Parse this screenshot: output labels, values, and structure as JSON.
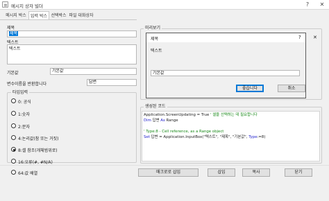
{
  "window": {
    "title": "메시지 상자 빌더",
    "help_glyph": "?",
    "close_glyph": "✕"
  },
  "tabs": [
    {
      "label": "메시지 박스",
      "active": false
    },
    {
      "label": "입력 박스",
      "active": true
    },
    {
      "label": "선택박스",
      "active": false
    },
    {
      "label": "파일 대화상자",
      "active": false
    }
  ],
  "form": {
    "title_label": "제목",
    "title_value": "제목",
    "message_label": "텍스트",
    "message_value": "텍스트",
    "default_label": "기본값",
    "default_value": "기본값",
    "return_var_label": "변수이름을 반환합니다",
    "return_var_value": "답변"
  },
  "input_type": {
    "legend": "타입입력",
    "options": [
      {
        "label": "0: 공식",
        "selected": false
      },
      {
        "label": "1:숫자",
        "selected": false
      },
      {
        "label": "2:문자",
        "selected": false
      },
      {
        "label": "4:논리값(참 또는 거짓)",
        "selected": false
      },
      {
        "label": "8:셀 참조(개체범위로)",
        "selected": true
      },
      {
        "label": "16:오류(#, #N/A)",
        "selected": false
      },
      {
        "label": "64:값 배열",
        "selected": false
      }
    ]
  },
  "preview": {
    "legend": "미리보기",
    "dialog_title": "제목",
    "help_glyph": "?",
    "close_glyph": "✕",
    "message": "텍스트",
    "input_value": "기본값",
    "ok_label": "좋습니다",
    "cancel_label": "취소"
  },
  "code": {
    "legend": "생성된 코드",
    "line1_main": "Application.ScreenUpdating = True",
    "line1_comment": "' 셀을 선택하는 데 필요합니다",
    "line2_kw1": "Dim",
    "line2_var": " 답변 ",
    "line2_kw2": "As",
    "line2_type": " Range",
    "line3": "",
    "line4": "' Type:8 - Cell reference, as a Range object",
    "line5_kw": "Set",
    "line5_main": " 답변 = Application.InputBox(\"텍스트\", \"제목\", \"기본값\", ",
    "line5_kw2": "Type",
    "line5_end": ":=8)"
  },
  "buttons": {
    "insert_label": "매크로로 삽입",
    "apply_label": "삽입",
    "copy_label": "복사",
    "close_label": "닫기"
  },
  "colors": {
    "selection": "#0078d7",
    "keyword": "#1a1acc",
    "comment": "#1a8a1a"
  }
}
